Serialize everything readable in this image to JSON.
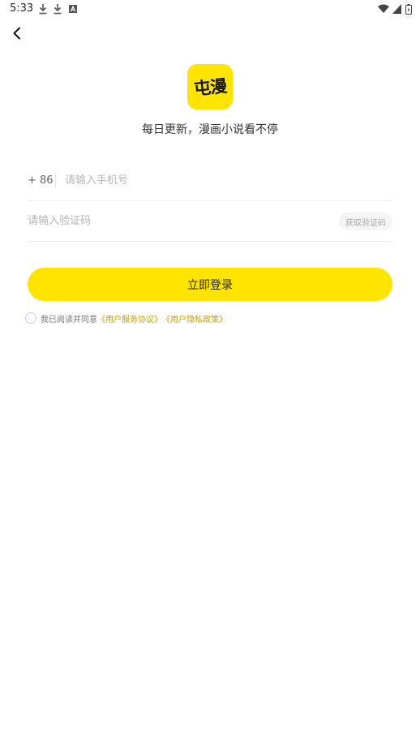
{
  "status_bar": {
    "time": "5:33",
    "left_icons": [
      "download-icon",
      "download-icon",
      "text-notification-icon"
    ],
    "right_icons": [
      "wifi-icon",
      "cellular-signal-icon",
      "battery-charging-icon"
    ]
  },
  "header": {
    "back_icon": "chevron-left-icon"
  },
  "brand": {
    "logo_text": "屯漫",
    "slogan": "每日更新，漫画小说看不停",
    "logo_color": "#ffe400"
  },
  "form": {
    "country_code": "+ 86",
    "phone_placeholder": "请输入手机号",
    "code_placeholder": "请输入验证码",
    "get_code_label": "获取验证码",
    "login_label": "立即登录"
  },
  "agreement": {
    "prefix": "我已阅读并同意",
    "user_agreement": "《用户服务协议》",
    "privacy_policy": "《用户隐私政策》",
    "checked": false
  },
  "colors": {
    "accent": "#ffe400",
    "link": "#c8a000"
  }
}
